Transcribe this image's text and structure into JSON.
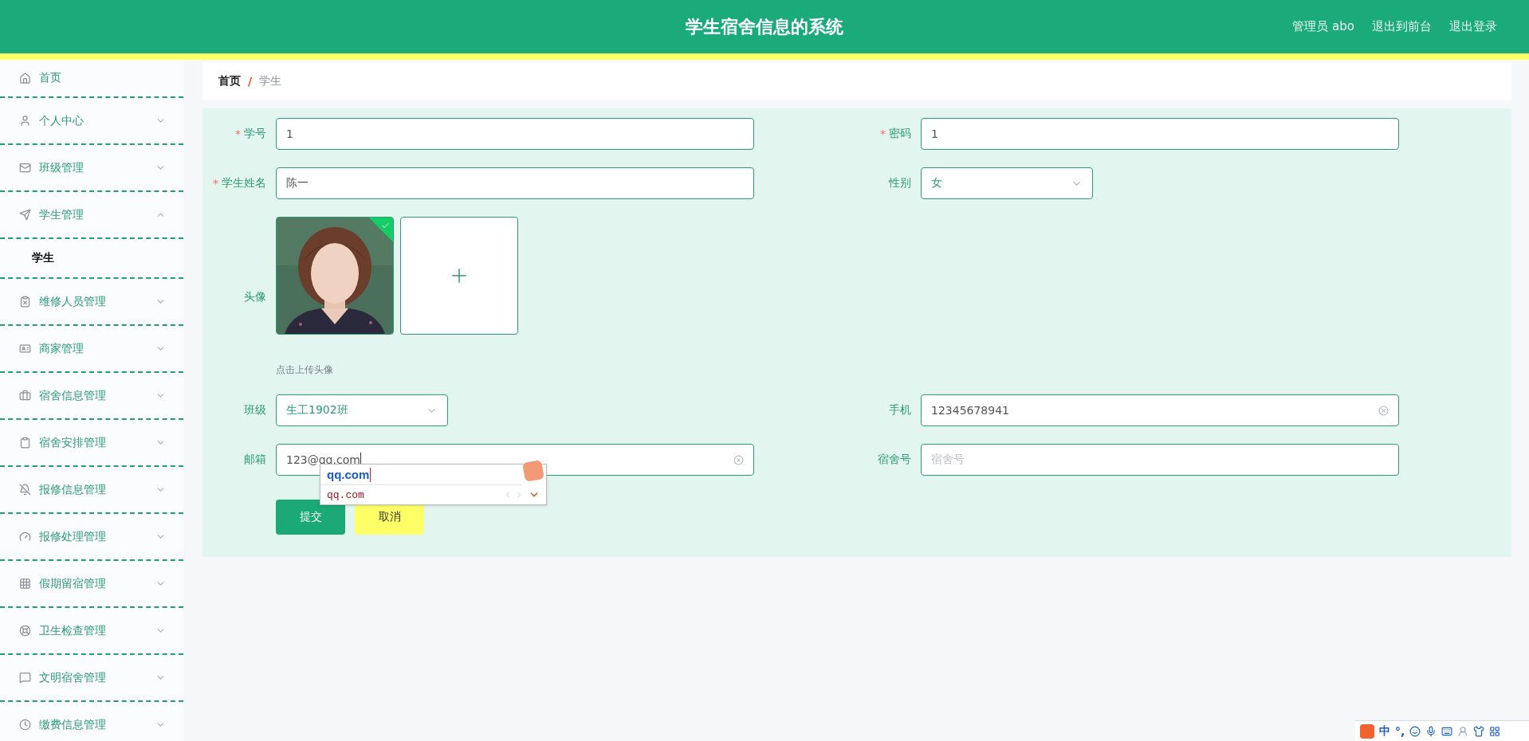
{
  "header": {
    "title": "学生宿舍信息的系统",
    "user": "管理员 abo",
    "links": [
      "退出到前台",
      "退出登录"
    ]
  },
  "sidebar": {
    "items": [
      {
        "label": "首页",
        "kind": "link"
      },
      {
        "label": "个人中心",
        "kind": "submenu",
        "expanded": false
      },
      {
        "label": "班级管理",
        "kind": "submenu",
        "expanded": false
      },
      {
        "label": "学生管理",
        "kind": "submenu",
        "expanded": true,
        "children": [
          {
            "label": "学生",
            "selected": true
          }
        ]
      },
      {
        "label": "维修人员管理",
        "kind": "submenu",
        "expanded": false
      },
      {
        "label": "商家管理",
        "kind": "submenu",
        "expanded": false
      },
      {
        "label": "宿舍信息管理",
        "kind": "submenu",
        "expanded": false
      },
      {
        "label": "宿舍安排管理",
        "kind": "submenu",
        "expanded": false
      },
      {
        "label": "报修信息管理",
        "kind": "submenu",
        "expanded": false
      },
      {
        "label": "报修处理管理",
        "kind": "submenu",
        "expanded": false
      },
      {
        "label": "假期留宿管理",
        "kind": "submenu",
        "expanded": false
      },
      {
        "label": "卫生检查管理",
        "kind": "submenu",
        "expanded": false
      },
      {
        "label": "文明宿舍管理",
        "kind": "submenu",
        "expanded": false
      },
      {
        "label": "缴费信息管理",
        "kind": "submenu",
        "expanded": false
      }
    ]
  },
  "breadcrumb": {
    "separator": "/",
    "items": [
      "首页",
      "学生"
    ]
  },
  "form": {
    "rows": [
      [
        {
          "kind": "text",
          "label": "学号",
          "marker": "*",
          "value": "1"
        },
        {
          "kind": "text",
          "label": "密码",
          "marker": "*",
          "value": "1"
        }
      ],
      [
        {
          "kind": "text",
          "label": "学生姓名",
          "marker": "*",
          "value": "陈一"
        },
        {
          "kind": "select",
          "label": "性别",
          "value": "女"
        }
      ],
      [
        {
          "kind": "upload",
          "label": "头像",
          "uploaded": true,
          "hint": "点击上传头像"
        }
      ],
      [
        {
          "kind": "select",
          "label": "班级",
          "value": "生工1902班"
        },
        {
          "kind": "text",
          "label": "手机",
          "value": "12345678941",
          "clearable": true
        }
      ],
      [
        {
          "kind": "text",
          "label": "邮箱",
          "value": "123@qq.com",
          "clearable": true,
          "focused": true
        },
        {
          "kind": "text",
          "label": "宿舍号",
          "placeholder": "宿舍号"
        }
      ]
    ],
    "buttons": [
      {
        "label": "提交",
        "kind": "primary"
      },
      {
        "label": "取消",
        "kind": "cancel"
      }
    ]
  },
  "ime_popup": {
    "composition": "qq.com",
    "candidate": "qq.com"
  },
  "ime_toolbar": {
    "items": [
      "中",
      "°,"
    ]
  }
}
